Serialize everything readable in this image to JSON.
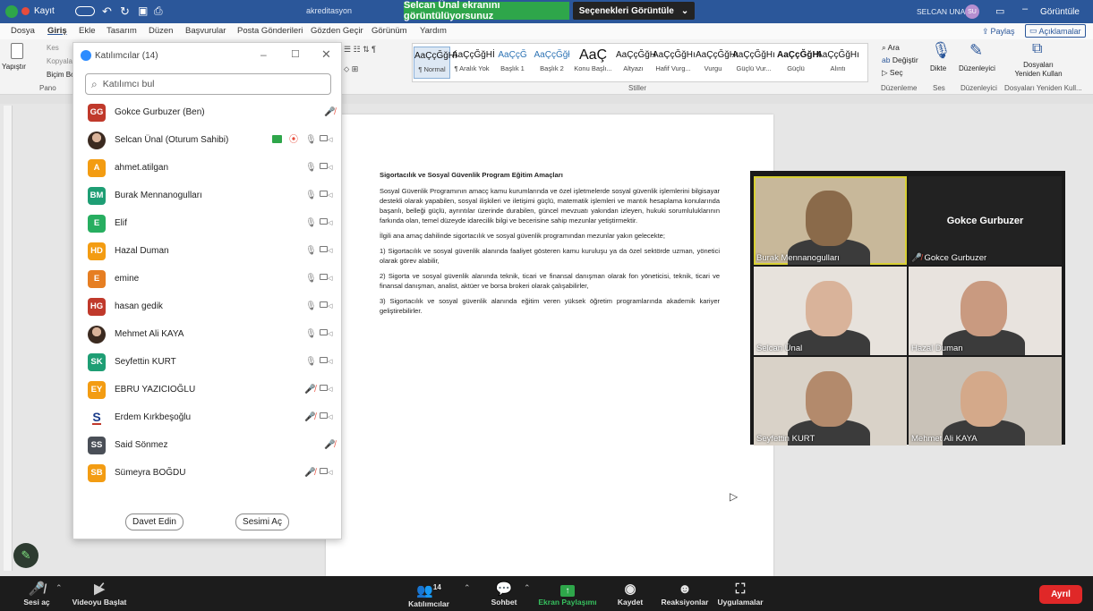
{
  "titlebar": {
    "record_label": "Kayıt",
    "doc_title": "akreditasyon",
    "zoom_share_banner": "Selcan Ünal ekranını görüntülüyorsunuz",
    "view_options_label": "Seçenekleri Görüntüle",
    "user_name": "SELCAN UNAL",
    "user_initials": "SU",
    "view_label": "Görüntüle"
  },
  "menu": {
    "items": [
      "Dosya",
      "Giriş",
      "Ekle",
      "Tasarım",
      "Düzen",
      "Başvurular",
      "Posta Gönderileri",
      "Gözden Geçir",
      "Görünüm",
      "Yardım"
    ],
    "share_label": "Paylaş",
    "comments_label": "Açıklamalar"
  },
  "ribbon": {
    "paste": "Yapıştır",
    "cut": "Kes",
    "copy": "Kopyala",
    "format_painter": "Biçim Bo",
    "clipboard_group": "Pano",
    "styles_group": "Stiller",
    "styles": [
      {
        "sample": "AaÇçĞğHİ",
        "name": "¶ Normal"
      },
      {
        "sample": "AaÇçĞğHİ",
        "name": "¶ Aralık Yok"
      },
      {
        "sample": "AaÇçĞ",
        "name": "Başlık 1"
      },
      {
        "sample": "AaÇçĞğł",
        "name": "Başlık 2"
      },
      {
        "sample": "AaÇ",
        "name": "Konu Başlı..."
      },
      {
        "sample": "AaÇçĞğH",
        "name": "Altyazı"
      },
      {
        "sample": "AaÇçĞğHı",
        "name": "Hafif Vurg..."
      },
      {
        "sample": "AaÇçĞğHı",
        "name": "Vurgu"
      },
      {
        "sample": "AaÇçĞğHı",
        "name": "Güçlü Vur..."
      },
      {
        "sample": "AaÇçĞğHI",
        "name": "Güçlü"
      },
      {
        "sample": "AaÇçĞğHı",
        "name": "Alıntı"
      }
    ],
    "find": "Ara",
    "replace": "Değiştir",
    "select": "Seç",
    "editing_group": "Düzenleme",
    "dictate": "Dikte",
    "voice_group": "Ses",
    "editor": "Düzenleyici",
    "editor_group": "Düzenleyici",
    "reuse_files": "Dosyaları Yeniden Kullan",
    "reuse_group": "Dosyaları Yeniden Kull..."
  },
  "document": {
    "heading": "Sigortacılık ve Sosyal Güvenlik Program Eğitim Amaçları",
    "paragraphs": [
      "Sosyal Güvenlik Programının amacç kamu kurumlarında ve özel işletmelerde sosyal güvenlik işlemlerini bilgisayar destekli olarak yapabilen, sosyal ilişkileri ve iletişimi güçlü, matematik işlemleri ve mantık hesaplama konularında başarılı, belleği güçlü, ayrıntılar üzerinde durabilen, güncel mevzuatı yakından izleyen, hukuki sorumluluklarının farkında olan, temel düzeyde idarecilik bilgi ve becerisine sahip mezunlar yetiştirmektir.",
      "İlgili ana amaç dahilinde sigortacılık ve sosyal güvenlik programından mezunlar yakın gelecekte;",
      "1) Sigortacılık ve sosyal güvenlik alanında faaliyet gösteren kamu kuruluşu ya da özel sektörde uzman, yönetici olarak görev alabilir,",
      "2) Sigorta ve sosyal güvenlik alanında teknik, ticari ve finansal danışman olarak fon yöneticisi, teknik, ticari ve finansal danışman, analist, aktüer ve borsa brokeri olarak çalışabilirler,",
      "3) Sigortacılık ve sosyal güvenlik alanında eğitim veren yüksek öğretim programlarında akademik kariyer geliştirebilirler."
    ]
  },
  "participants": {
    "title": "Katılımcılar (14)",
    "search_placeholder": "Katılımcı bul",
    "invite_label": "Davet Edin",
    "unmute_label": "Sesimi Aç",
    "list": [
      {
        "initials": "GG",
        "color": "#c0392b",
        "name": "Gokce Gurbuzer (Ben)",
        "mic": "muted",
        "cam": false
      },
      {
        "initials": "",
        "color": "#8a7a6a",
        "name": "Selcan Ünal (Oturum Sahibi)",
        "mic": "on",
        "cam": true,
        "host": true,
        "photo": true
      },
      {
        "initials": "A",
        "color": "#f39c12",
        "name": "ahmet.atilgan",
        "mic": "on",
        "cam": true
      },
      {
        "initials": "BM",
        "color": "#1e9e74",
        "name": "Burak Mennanogulları",
        "mic": "on",
        "cam": true
      },
      {
        "initials": "E",
        "color": "#27ae60",
        "name": "Elif",
        "mic": "on",
        "cam": true
      },
      {
        "initials": "HD",
        "color": "#f39c12",
        "name": "Hazal Duman",
        "mic": "on",
        "cam": true
      },
      {
        "initials": "E",
        "color": "#e67e22",
        "name": "emine",
        "mic": "on",
        "cam": true
      },
      {
        "initials": "HG",
        "color": "#c0392b",
        "name": "hasan gedik",
        "mic": "on",
        "cam": true
      },
      {
        "initials": "",
        "color": "#7a6a5a",
        "name": "Mehmet Ali KAYA",
        "mic": "on",
        "cam": true,
        "photo": true
      },
      {
        "initials": "SK",
        "color": "#1e9e74",
        "name": "Seyfettin KURT",
        "mic": "on",
        "cam": true
      },
      {
        "initials": "EY",
        "color": "#f39c12",
        "name": "EBRU YAZICIOĞLU",
        "mic": "muted",
        "cam": true
      },
      {
        "initials": "",
        "color": "#ffffff",
        "name": "Erdem Kırkbeşoğlu",
        "mic": "muted",
        "cam": true,
        "logo": true
      },
      {
        "initials": "SS",
        "color": "#4a4f57",
        "name": "Said Sönmez",
        "mic": "muted",
        "cam": false
      },
      {
        "initials": "SB",
        "color": "#f39c12",
        "name": "Sümeyra BOĞDU",
        "mic": "muted",
        "cam": true
      }
    ]
  },
  "gallery": {
    "tiles": [
      {
        "name": "Burak Mennanogulları",
        "video": true,
        "skin": "#8a6a4a",
        "bg": "#c8b89a",
        "active": true
      },
      {
        "name": "Gokce Gurbuzer",
        "video": false,
        "muted": true
      },
      {
        "name": "Selcan Ünal",
        "video": true,
        "skin": "#d9b39a",
        "bg": "#e7e2dc"
      },
      {
        "name": "Hazal Duman",
        "video": true,
        "skin": "#c99a80",
        "bg": "#e8e3de"
      },
      {
        "name": "Seyfettin KURT",
        "video": true,
        "skin": "#b38a6c",
        "bg": "#d9d2c8"
      },
      {
        "name": "Mehmet Ali KAYA",
        "video": true,
        "skin": "#d4a98a",
        "bg": "#c9c2b8"
      }
    ]
  },
  "toolbar": {
    "audio": "Sesi aç",
    "video": "Videoyu Başlat",
    "participants": "Katılımcılar",
    "participants_count": "14",
    "chat": "Sohbet",
    "share": "Ekran Paylaşımı",
    "record": "Kaydet",
    "reactions": "Reaksiyonlar",
    "apps": "Uygulamalar",
    "leave": "Ayrıl"
  },
  "colors": {
    "word_blue": "#2b579a",
    "share_green": "#2ea64a",
    "leave_red": "#e02828"
  }
}
